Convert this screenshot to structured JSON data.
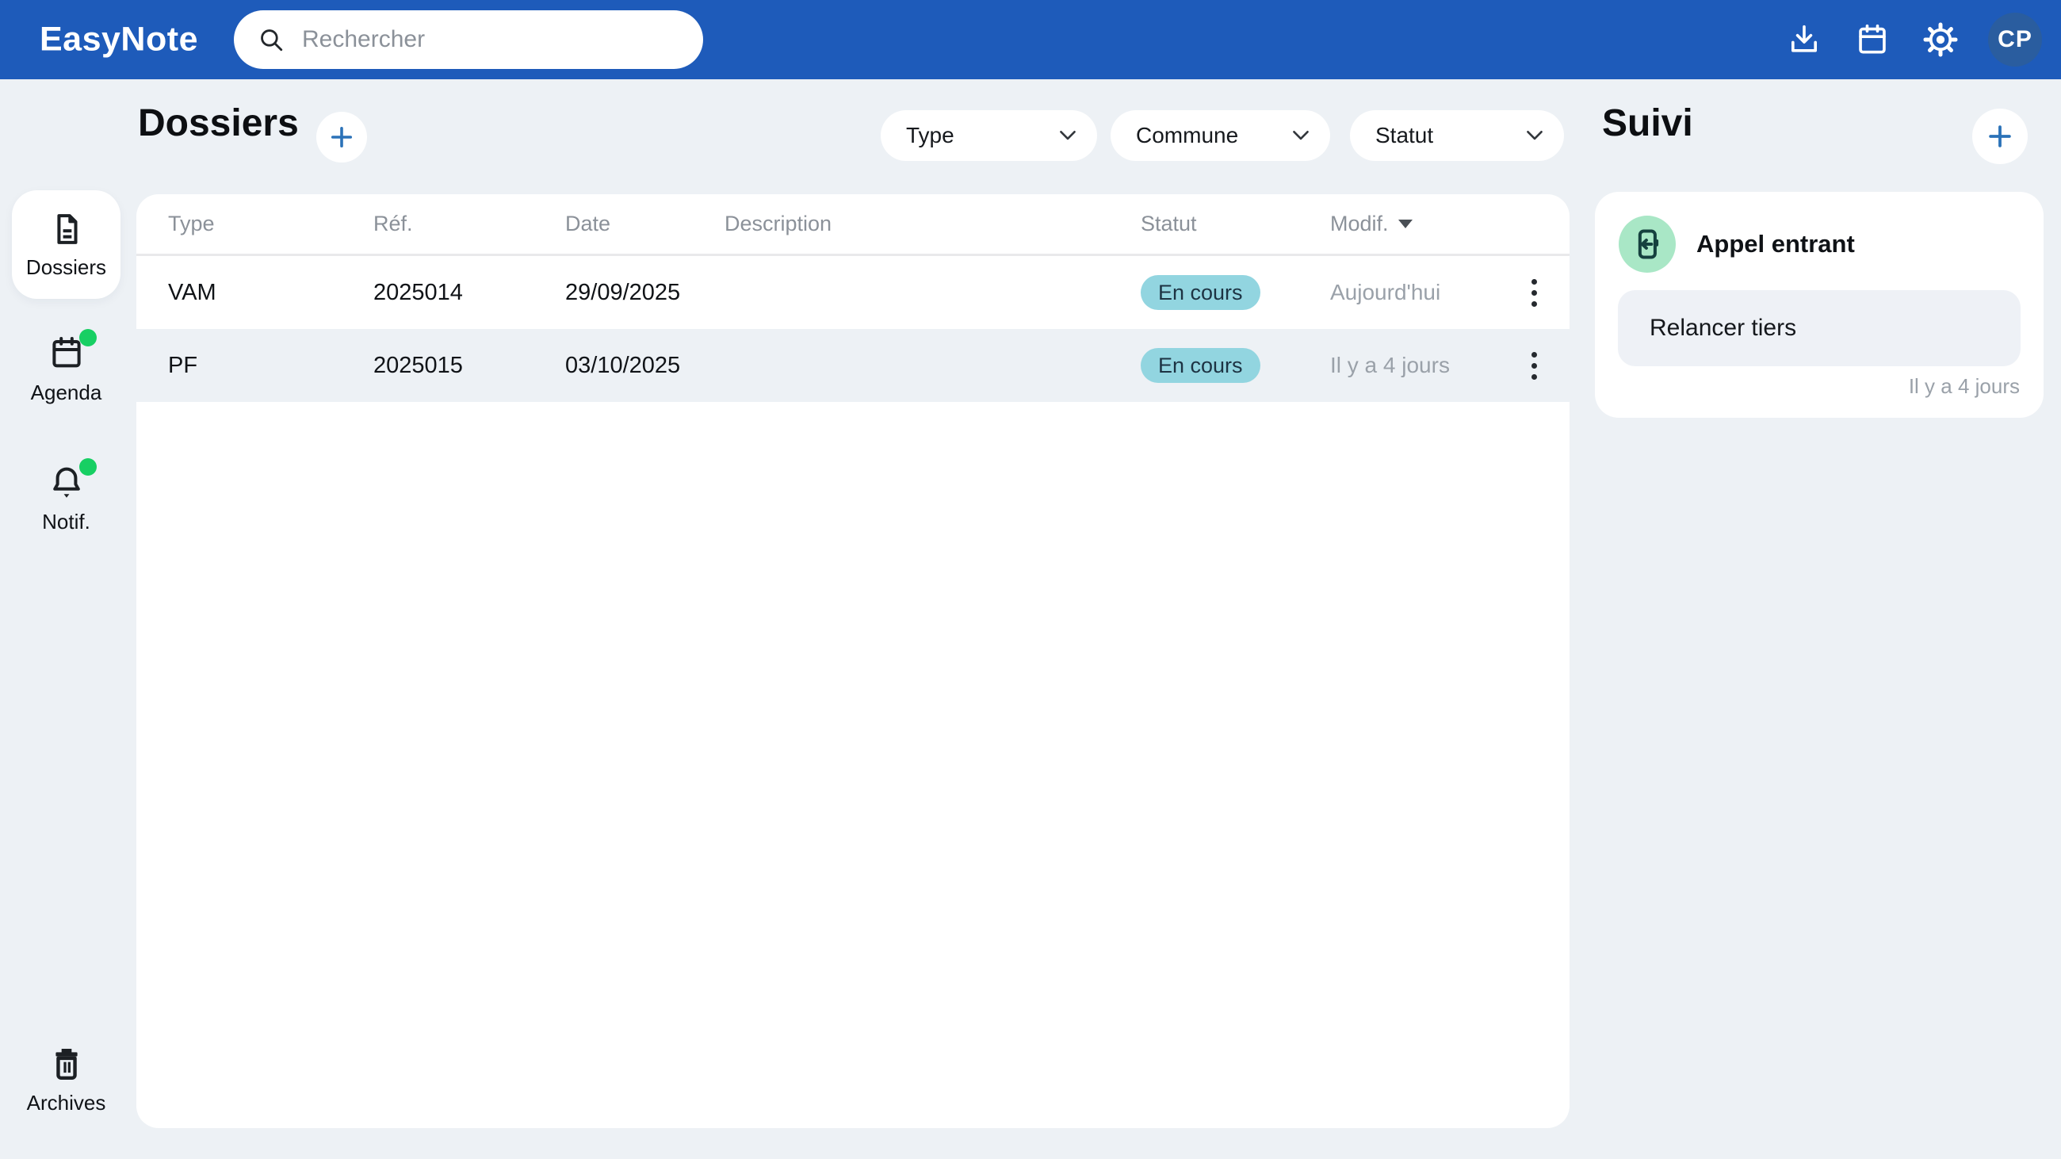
{
  "header": {
    "app_name": "EasyNote",
    "search_placeholder": "Rechercher",
    "avatar_initials": "CP",
    "icons": [
      "download-icon",
      "calendar-icon",
      "gear-icon"
    ]
  },
  "sidebar": {
    "items": [
      {
        "label": "Dossiers",
        "icon": "document-icon",
        "active": true,
        "has_badge": false
      },
      {
        "label": "Agenda",
        "icon": "calendar-icon",
        "active": false,
        "has_badge": true
      },
      {
        "label": "Notif.",
        "icon": "bell-icon",
        "active": false,
        "has_badge": true
      },
      {
        "label": "Archives",
        "icon": "trash-icon",
        "active": false,
        "has_badge": false
      }
    ]
  },
  "main": {
    "title": "Dossiers",
    "add_button": "+",
    "filters": [
      {
        "label": "Type"
      },
      {
        "label": "Commune"
      },
      {
        "label": "Statut"
      }
    ],
    "table": {
      "headers": [
        "Type",
        "Réf.",
        "Date",
        "Description",
        "Statut",
        "Modif."
      ],
      "sorted_by": "Modif.",
      "sort_direction": "desc",
      "rows": [
        {
          "type": "VAM",
          "ref": "2025014",
          "date": "29/09/2025",
          "description": "",
          "statut": "En cours",
          "modif": "Aujourd'hui"
        },
        {
          "type": "PF",
          "ref": "2025015",
          "date": "03/10/2025",
          "description": "",
          "statut": "En cours",
          "modif": "Il y a 4 jours"
        }
      ]
    }
  },
  "suivi": {
    "title": "Suivi",
    "add_button": "+",
    "cards": [
      {
        "icon": "incoming-call-icon",
        "title": "Appel entrant",
        "note": "Relancer tiers",
        "timestamp": "Il y a 4 jours"
      }
    ]
  },
  "colors": {
    "header_blue": "#1e5bba",
    "page_background": "#edf1f5",
    "accent_blue": "#2b72b8",
    "avatar_blue": "#2a5d9f",
    "badge_background": "#92d5e0",
    "badge_text": "#1d3343",
    "notification_green": "#17cf63",
    "suivi_icon_green": "#a9e7c6",
    "muted_text": "#9aa1a9"
  }
}
